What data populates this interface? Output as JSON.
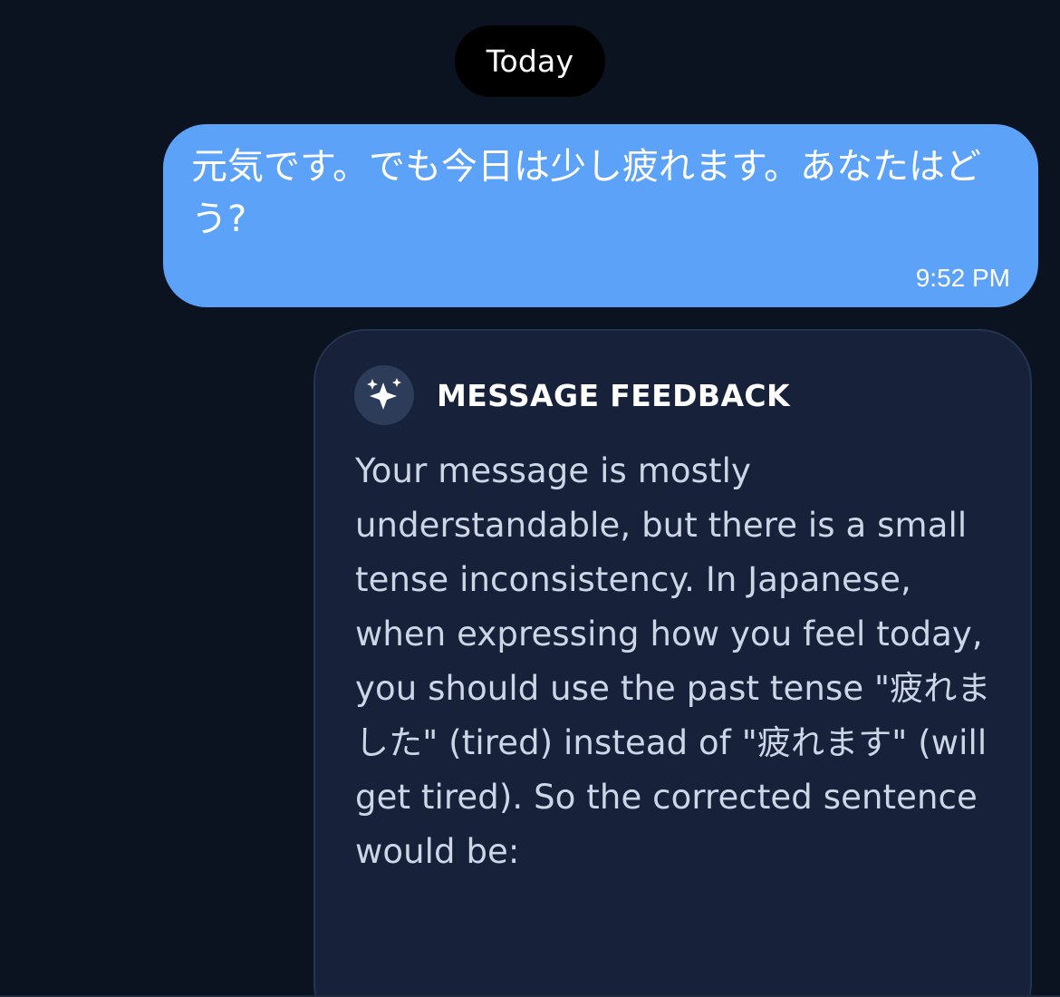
{
  "chat": {
    "date_separator": "Today",
    "user_message": {
      "text": "元気です。でも今日は少し疲れます。あなたはどう?",
      "time": "9:52 PM",
      "bubble_color": "#5ca2f8"
    },
    "feedback": {
      "icon": "sparkle-icon",
      "title": "MESSAGE FEEDBACK",
      "body": "Your message is mostly understandable, but there is a small tense inconsistency. In Japanese, when expressing how you feel today, you should use the past tense \"疲れました\" (tired) instead of \"疲れます\" (will get tired). So the corrected sentence would be:",
      "card_color": "#17213a",
      "border_color": "#24344f"
    }
  },
  "colors": {
    "background": "#0b1220",
    "date_pill": "#000000",
    "text_primary": "#ffffff",
    "text_secondary": "#cdd6e6"
  }
}
